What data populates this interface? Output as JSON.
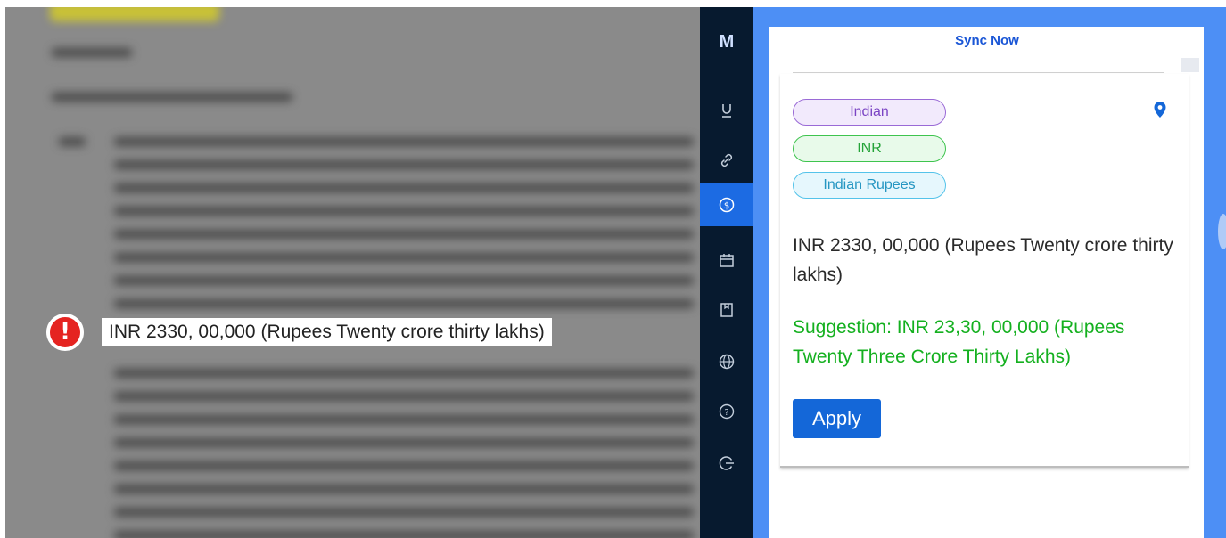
{
  "document": {
    "flagged_text": "INR 2330, 00,000 (Rupees Twenty crore thirty lakhs)",
    "alert_icon": "exclamation-circle-icon",
    "alert_color": "#e52421"
  },
  "sidebar": {
    "logo": "M",
    "items": [
      {
        "icon": "underline-icon",
        "glyph": "U",
        "active": false
      },
      {
        "icon": "link-icon",
        "glyph": "🔗",
        "active": false
      },
      {
        "icon": "dollar-icon",
        "glyph": "$",
        "active": true
      },
      {
        "icon": "calendar-icon",
        "glyph": "▭",
        "active": false
      },
      {
        "icon": "bookmark-icon",
        "glyph": "▯",
        "active": false
      },
      {
        "icon": "globe-icon",
        "glyph": "⊕",
        "active": false
      },
      {
        "icon": "help-icon",
        "glyph": "?",
        "active": false
      },
      {
        "icon": "logout-icon",
        "glyph": "G",
        "active": false
      }
    ],
    "active_color": "#1c6be3"
  },
  "panel": {
    "sync_label": "Sync Now",
    "tags": [
      "Indian",
      "INR",
      "Indian Rupees"
    ],
    "location_icon": "location-pin-icon",
    "original_text": "INR 2330, 00,000 (Rupees Twenty crore thirty lakhs)",
    "suggestion_text": "Suggestion: INR 23,30, 00,000 (Rupees Twenty Three Crore Thirty Lakhs)",
    "apply_label": "Apply",
    "accent_color": "#4d8ff5",
    "suggestion_color": "#14b01f"
  }
}
